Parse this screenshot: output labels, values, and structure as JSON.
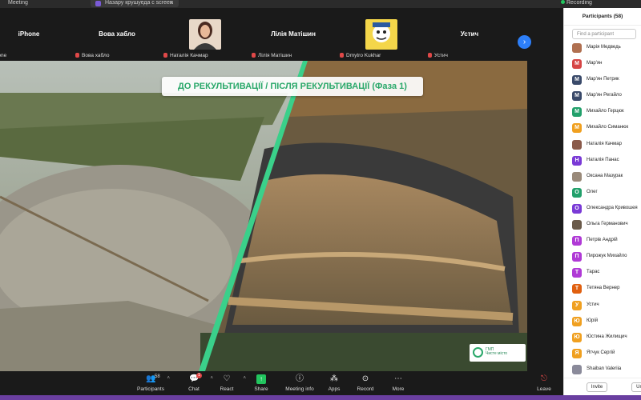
{
  "topbar": {
    "app_title": "Meeting",
    "share_tab": "Назару крушуеда с screen",
    "recording": "Recording"
  },
  "strip": {
    "tiles": [
      {
        "big": "iPhone",
        "name": "iPhone"
      },
      {
        "big": "Вова хабло",
        "name": "Вова хабло"
      },
      {
        "big": "",
        "name": "Наталія Качмар"
      },
      {
        "big": "Лілія Матішин",
        "name": "Лілія Матішин"
      },
      {
        "big": "",
        "name": "Dmytro Kukhar"
      },
      {
        "big": "Устич",
        "name": "Устич"
      }
    ]
  },
  "slide": {
    "title": "ДО РЕКУЛЬТИВАЦІЇ / ПІСЛЯ РЕКУЛЬТИВАЦІЇ (Фаза 1)",
    "logo_line1": "ГМП",
    "logo_line2": "Чисте місто"
  },
  "toolbar": {
    "participants_label": "Participants",
    "participants_count": "58",
    "chat_label": "Chat",
    "chat_badge": "1",
    "react_label": "React",
    "share_label": "Share",
    "info_label": "Meeting info",
    "apps_label": "Apps",
    "record_label": "Record",
    "more_label": "More",
    "leave_label": "Leave"
  },
  "panel": {
    "header": "Participants (58)",
    "search_placeholder": "Find a participant",
    "participants": [
      {
        "initial": "",
        "name": "Марія Медведь",
        "color": "#b07050"
      },
      {
        "initial": "М",
        "name": "Мар'ян",
        "color": "#d64545"
      },
      {
        "initial": "М",
        "name": "Мар'ян Петрик",
        "color": "#3a4a6a"
      },
      {
        "initial": "М",
        "name": "Мар'ян Регайло",
        "color": "#3a4a6a"
      },
      {
        "initial": "М",
        "name": "Михайло Герцюк",
        "color": "#22a06b"
      },
      {
        "initial": "М",
        "name": "Михайло Симанюк",
        "color": "#f0a020"
      },
      {
        "initial": "",
        "name": "Наталія Качмар",
        "color": "#8a5a4a"
      },
      {
        "initial": "Н",
        "name": "Наталія Панас",
        "color": "#7a3ad6"
      },
      {
        "initial": "",
        "name": "Оксана Мазурак",
        "color": "#9a8a7a"
      },
      {
        "initial": "О",
        "name": "Олег",
        "color": "#22a06b"
      },
      {
        "initial": "О",
        "name": "Олександра Кривошея",
        "color": "#7a3ad6"
      },
      {
        "initial": "",
        "name": "Ольга Германович",
        "color": "#6a5a4a"
      },
      {
        "initial": "П",
        "name": "Петрів Андрій",
        "color": "#b03ad6"
      },
      {
        "initial": "П",
        "name": "Пирожук Михайло",
        "color": "#b03ad6"
      },
      {
        "initial": "Т",
        "name": "Тарас",
        "color": "#b03ad6"
      },
      {
        "initial": "Т",
        "name": "Тетяна Вернер",
        "color": "#e06010"
      },
      {
        "initial": "У",
        "name": "Устич",
        "color": "#f0a020"
      },
      {
        "initial": "Ю",
        "name": "Юрій",
        "color": "#f0a020"
      },
      {
        "initial": "Ю",
        "name": "Юстина Жилищич",
        "color": "#f0a020"
      },
      {
        "initial": "Я",
        "name": "Ятчук Сергій",
        "color": "#f0a020"
      },
      {
        "initial": "",
        "name": "Shaiban Valeriia",
        "color": "#8a8a9a"
      }
    ],
    "invite_label": "Invite",
    "unmute_label": "Un"
  }
}
